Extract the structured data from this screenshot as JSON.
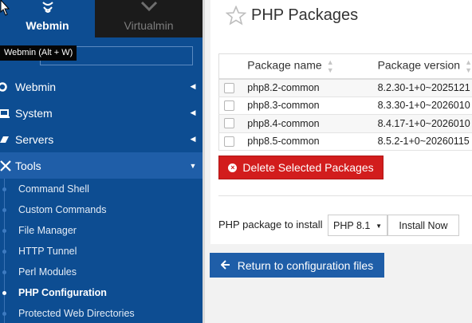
{
  "switcher": {
    "webmin_label": "Webmin",
    "virtualmin_label": "Virtualmin",
    "webmin_icon": "webmin-logo-icon",
    "virtualmin_icon": "virtualmin-logo-icon"
  },
  "tooltip": "Webmin (Alt + W)",
  "search": {
    "placeholder": ""
  },
  "menu": [
    {
      "label": "Webmin",
      "icon": "gear-icon",
      "caret": "◀"
    },
    {
      "label": "System",
      "icon": "monitor-icon",
      "caret": "◀"
    },
    {
      "label": "Servers",
      "icon": "rocket-icon",
      "caret": "◀"
    },
    {
      "label": "Tools",
      "icon": "wrench-screwdriver-icon",
      "caret": "▼"
    }
  ],
  "tools_submenu": [
    "Command Shell",
    "Custom Commands",
    "File Manager",
    "HTTP Tunnel",
    "Perl Modules",
    "PHP Configuration",
    "Protected Web Directories"
  ],
  "page": {
    "title": "PHP Packages",
    "columns": [
      "Package name",
      "Package version"
    ],
    "rows": [
      {
        "name": "php8.2-common",
        "version": "8.2.30-1+0~2025121"
      },
      {
        "name": "php8.3-common",
        "version": "8.3.30-1+0~2026010"
      },
      {
        "name": "php8.4-common",
        "version": "8.4.17-1+0~2026010"
      },
      {
        "name": "php8.5-common",
        "version": "8.5.2-1+0~20260115"
      }
    ],
    "delete_button": "Delete Selected Packages",
    "install_label": "PHP package to install",
    "install_select_value": "PHP 8.1",
    "install_button": "Install Now",
    "return_button": "Return to configuration files"
  },
  "colors": {
    "sidebar": "#0d4d92",
    "accent": "#1f5ea8",
    "danger": "#d21d1d"
  }
}
